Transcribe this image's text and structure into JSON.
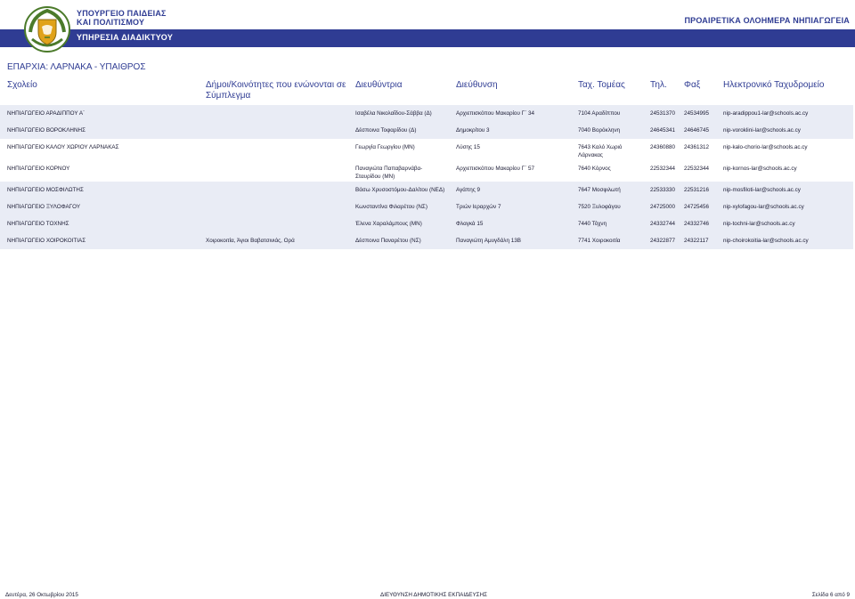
{
  "header": {
    "ministry_line1": "ΥΠΟΥΡΓΕΙΟ ΠΑΙΔΕΙΑΣ",
    "ministry_line2": "ΚΑΙ ΠΟΛΙΤΙΣΜΟΥ",
    "service": "ΥΠΗΡΕΣΙΑ ΔΙΑΔΙΚΤΥΟΥ",
    "program": "ΠΡΟΑΙΡΕΤΙΚΑ ΟΛΟΗΜΕΡΑ ΝΗΠΙΑΓΩΓΕΙΑ",
    "logo_icon": "cyprus-coat-of-arms-icon",
    "accent_color": "#2f3c93"
  },
  "district": "ΕΠΑΡΧΙΑ:  ΛΑΡΝΑΚΑ - ΥΠΑΙΘΡΟΣ",
  "columns": {
    "school": "Σχολείο",
    "municipalities_line1": "Δήμοι/Κοινότητες που ενώνονται σε",
    "municipalities_line2": "Σύμπλεγμα",
    "director": "Διευθύντρια",
    "address": "Διεύθυνση",
    "postal": "Ταχ. Τομέας",
    "phone": "Τηλ.",
    "fax": "Φαξ",
    "email": "Ηλεκτρονικό Ταχυδρομείο"
  },
  "rows": [
    {
      "name": "ΝΗΠΙΑΓΩΓΕΙΟ ΑΡΑΔΙΠΠΟΥ Α΄",
      "mun": "",
      "dir": "Ισαβέλα Νικολαΐδου-Σάββα (Δ)",
      "addr": "Αρχιεπισκόπου Μακαρίου Γ΄ 34",
      "tk": "7104 Αραδίππου",
      "tel": "24531370",
      "fax": "24534995",
      "mail": "nip-aradippou1-lar@schools.ac.cy"
    },
    {
      "name": "ΝΗΠΙΑΓΩΓΕΙΟ ΒΟΡΟΚΛΗΝΗΣ",
      "mun": "",
      "dir": "Δέσποινα Τοφαρίδου (Δ)",
      "addr": "Δημοκρίτου 3",
      "tk": "7040 Βορόκληνη",
      "tel": "24645341",
      "fax": "24646745",
      "mail": "nip-voroklini-lar@schools.ac.cy"
    },
    {
      "name": "ΝΗΠΙΑΓΩΓΕΙΟ ΚΑΛΟΥ ΧΩΡΙΟΥ ΛΑΡΝΑΚΑΣ",
      "mun": "",
      "dir": "Γεωργία Γεωργίου (ΜΝ)",
      "addr": "Λύσης 15",
      "tk": "7643 Καλό Χωριό Λάρνακας",
      "tel": "24360880",
      "fax": "24361312",
      "mail": "nip-kalo-chorio-lar@schools.ac.cy"
    },
    {
      "name": "ΝΗΠΙΑΓΩΓΕΙΟ ΚΟΡΝΟΥ",
      "mun": "",
      "dir": "Παναγιώτα Παπαβαρνάβα-Σταυρίδου (ΜΝ)",
      "addr": "Αρχιεπισκόπου Μακαρίου Γ΄ 57",
      "tk": "7640 Κόρνος",
      "tel": "22532344",
      "fax": "22532344",
      "mail": "nip-kornos-lar@schools.ac.cy"
    },
    {
      "name": "ΝΗΠΙΑΓΩΓΕΙΟ ΜΟΣΦΙΛΩΤΗΣ",
      "mun": "",
      "dir": "Βάσω Χρυσοστόμου-Δαλίτου (ΝΕΔ)",
      "addr": "Αγάπης 9",
      "tk": "7647 Μοσφιλωτή",
      "tel": "22533330",
      "fax": "22531216",
      "mail": "nip-mosfiloti-lar@schools.ac.cy"
    },
    {
      "name": "ΝΗΠΙΑΓΩΓΕΙΟ ΞΥΛΟΦΑΓΟΥ",
      "mun": "",
      "dir": "Κωνσταντίνα Φιλαρέτου (ΝΣ)",
      "addr": "Τριών Ιεραρχών 7",
      "tk": "7520 Ξυλοφάγου",
      "tel": "24725000",
      "fax": "24725456",
      "mail": "nip-xylofagou-lar@schools.ac.cy"
    },
    {
      "name": "ΝΗΠΙΑΓΩΓΕΙΟ ΤΟΧΝΗΣ",
      "mun": "",
      "dir": "Έλενα Χαραλάμπους (ΜΝ)",
      "addr": "Φλαγκά 15",
      "tk": "7440 Τόχνη",
      "tel": "24332744",
      "fax": "24332746",
      "mail": "nip-tochni-lar@schools.ac.cy"
    },
    {
      "name": "ΝΗΠΙΑΓΩΓΕΙΟ ΧΟΙΡΟΚΟΙΤΙΑΣ",
      "mun": "Χοιροκοιτία, Άγιοι Βαβατσινιάς, Ορά",
      "dir": "Δέσποινα Παναρέτου (ΝΣ)",
      "addr": "Παναγιώτη Αμυγδάλη 13Β",
      "tk": "7741 Χοιροκοιτία",
      "tel": "24322877",
      "fax": "24322117",
      "mail": "nip-choirokoitia-lar@schools.ac.cy"
    }
  ],
  "footer": {
    "date": "Δευτέρα, 26 Οκτωβρίου 2015",
    "department": "ΔΙΕΥΘΥΝΣΗ ΔΗΜΟΤΙΚΗΣ ΕΚΠΑΙΔΕΥΣΗΣ",
    "page": "Σελίδα 6 από 9"
  }
}
